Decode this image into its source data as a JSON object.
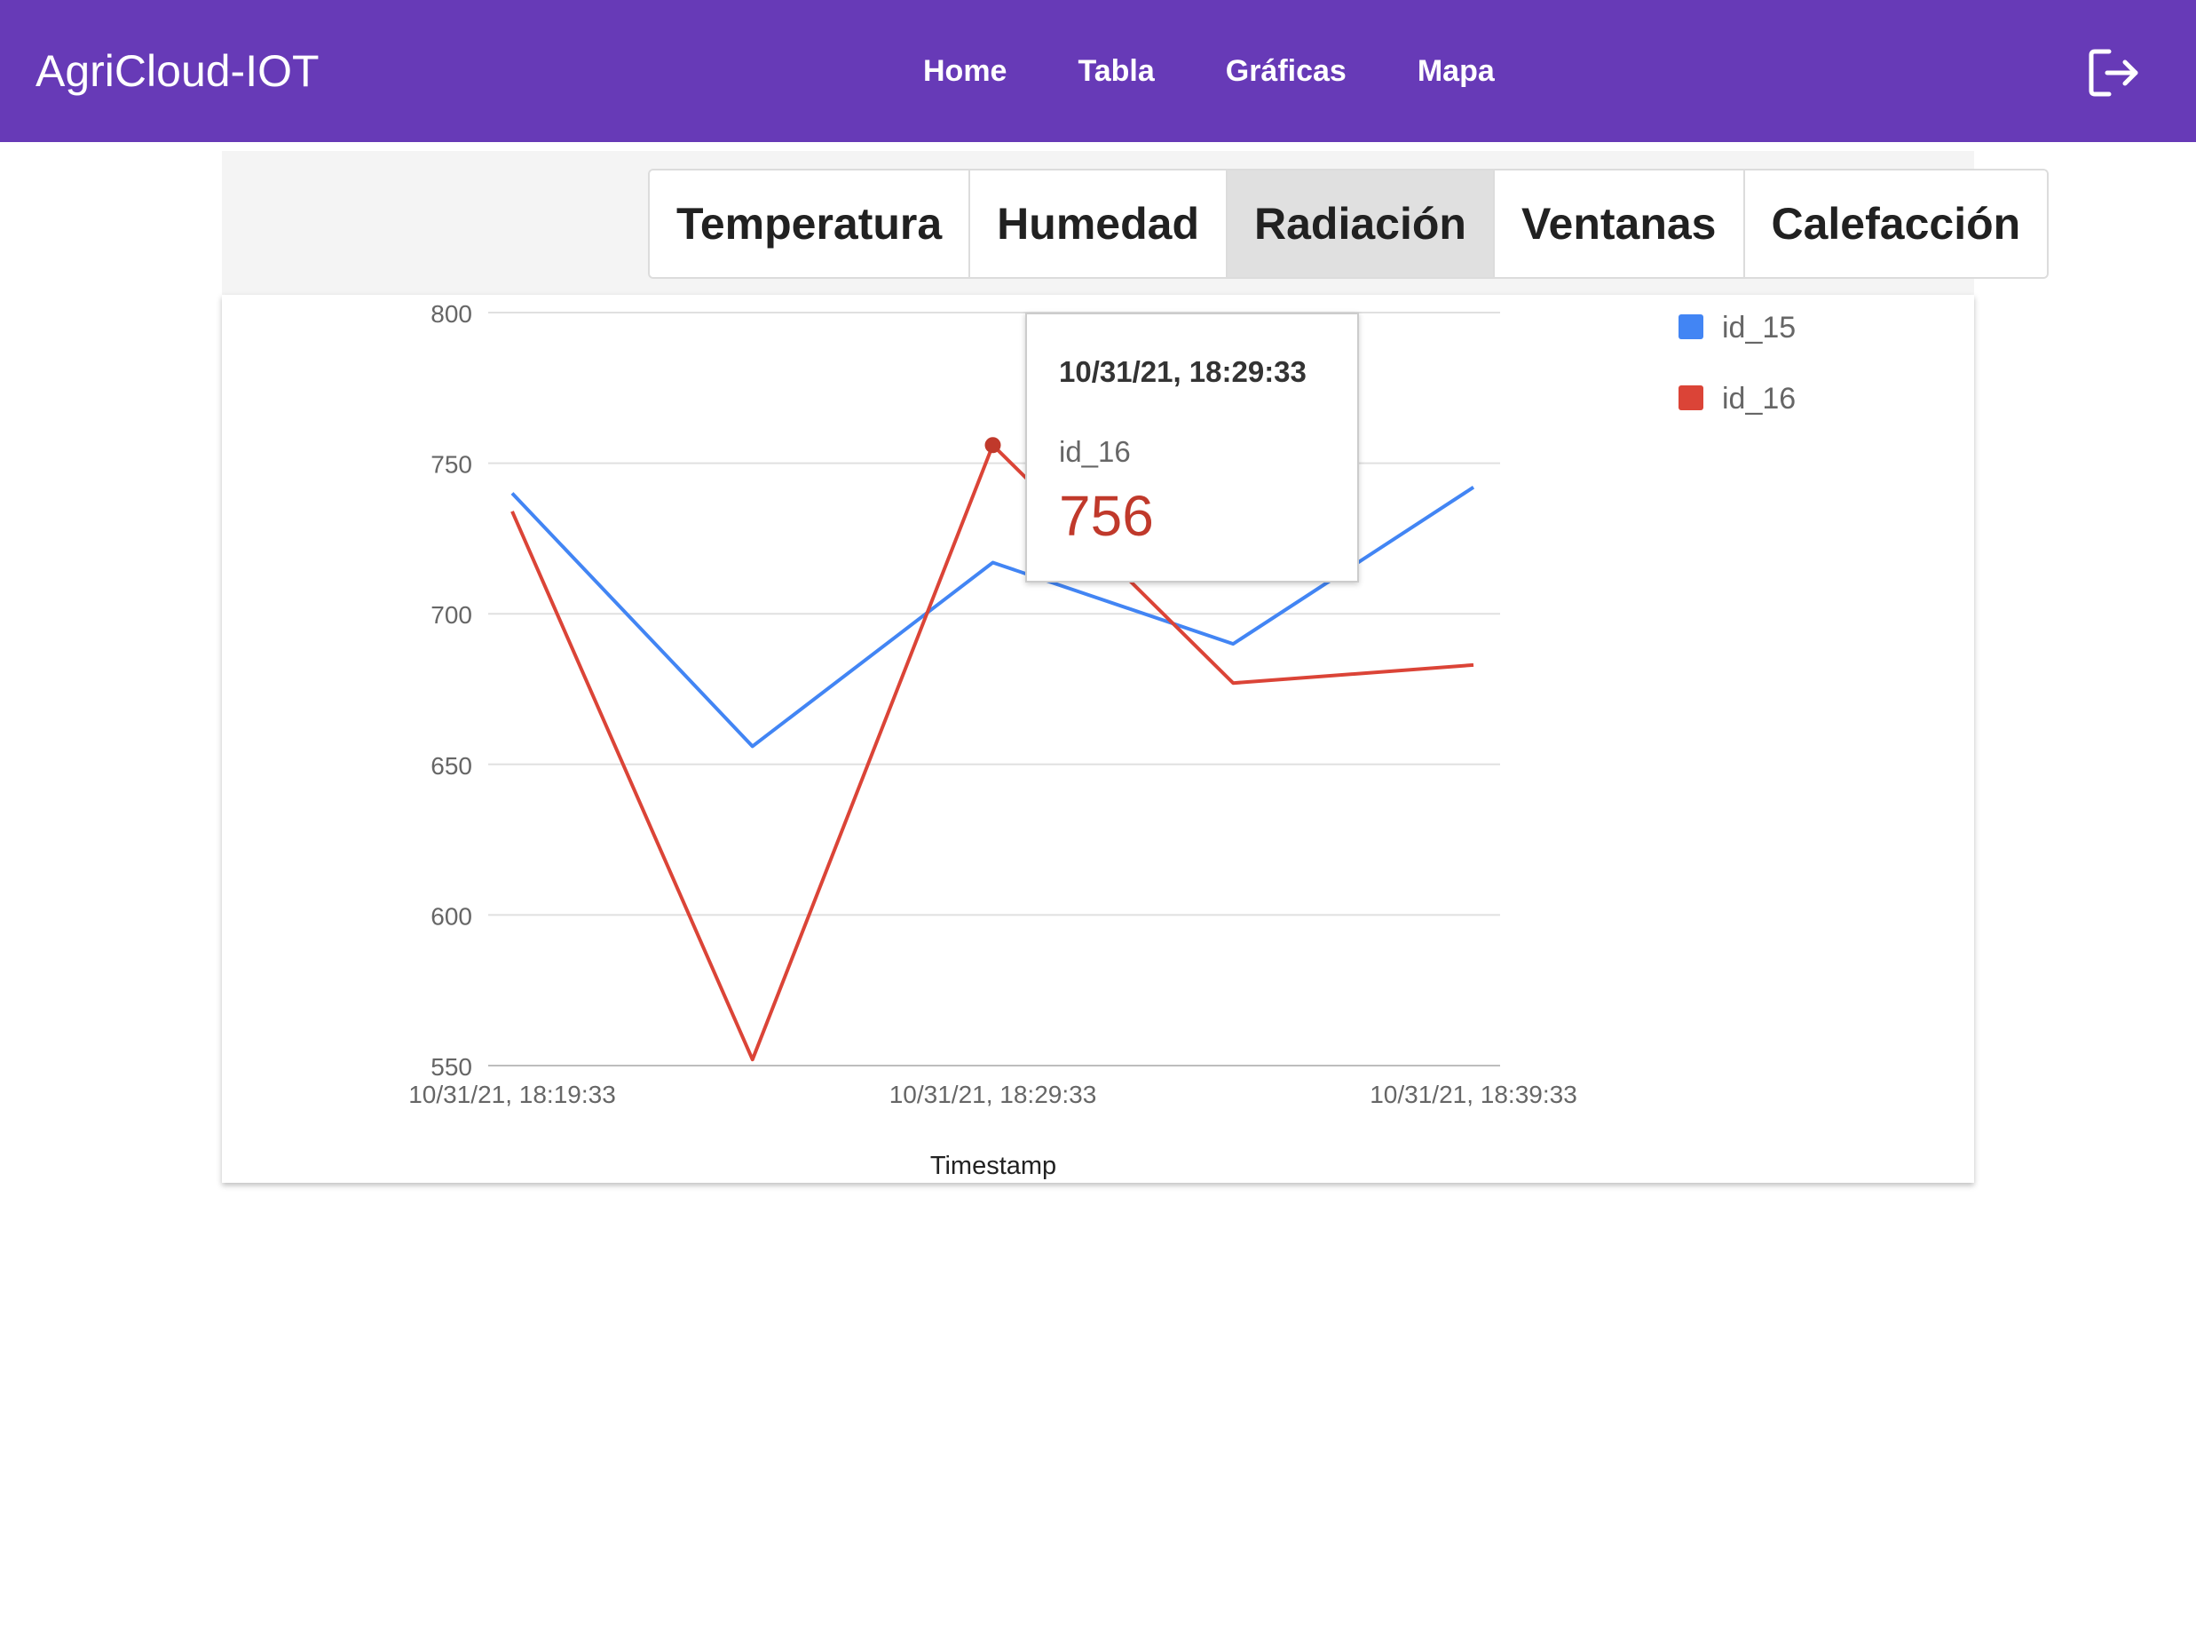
{
  "app": {
    "brand": "AgriCloud-IOT",
    "nav": [
      "Home",
      "Tabla",
      "Gráficas",
      "Mapa"
    ],
    "logout_icon": "logout-icon"
  },
  "tabs": [
    {
      "label": "Temperatura",
      "active": false
    },
    {
      "label": "Humedad",
      "active": false
    },
    {
      "label": "Radiación",
      "active": true
    },
    {
      "label": "Ventanas",
      "active": false
    },
    {
      "label": "Calefacción",
      "active": false
    }
  ],
  "colors": {
    "navbar": "#673ab7",
    "series_id_15": "#4285f4",
    "series_id_16": "#db4437"
  },
  "tooltip": {
    "time": "10/31/21, 18:29:33",
    "series": "id_16",
    "value": "756"
  },
  "chart_data": {
    "type": "line",
    "xlabel": "Timestamp",
    "ylabel": "",
    "x": [
      "10/31/21, 18:19:33",
      "10/31/21, 18:24:33",
      "10/31/21, 18:29:33",
      "10/31/21, 18:34:33",
      "10/31/21, 18:39:33"
    ],
    "x_tick_labels": [
      "10/31/21, 18:19:33",
      "10/31/21, 18:29:33",
      "10/31/21, 18:39:33"
    ],
    "y_ticks": [
      550,
      600,
      650,
      700,
      750,
      800
    ],
    "ylim": [
      550,
      800
    ],
    "grid": true,
    "legend_position": "right",
    "series": [
      {
        "name": "id_15",
        "values": [
          740,
          656,
          717,
          690,
          742
        ]
      },
      {
        "name": "id_16",
        "values": [
          734,
          552,
          756,
          677,
          683
        ]
      }
    ]
  }
}
